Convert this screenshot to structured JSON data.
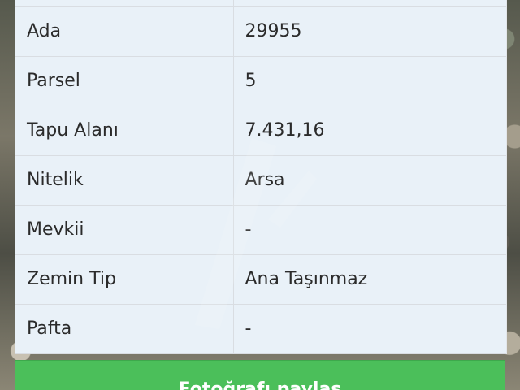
{
  "rows": [
    {
      "label": "Ada",
      "value": "29955"
    },
    {
      "label": "Parsel",
      "value": "5"
    },
    {
      "label": "Tapu Alanı",
      "value": "7.431,16"
    },
    {
      "label": "Nitelik",
      "value": "Arsa"
    },
    {
      "label": "Mevkii",
      "value": "-"
    },
    {
      "label": "Zemin Tip",
      "value": "Ana Taşınmaz"
    },
    {
      "label": "Pafta",
      "value": "-"
    }
  ],
  "action_button": {
    "label": "Fotoğrafı paylaş"
  },
  "colors": {
    "row_background": "#e9f1f8",
    "action_green": "#4bbf5a",
    "text": "#2b2b2b"
  }
}
